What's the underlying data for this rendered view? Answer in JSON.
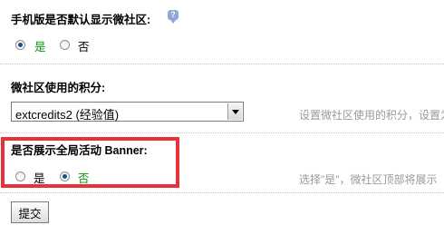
{
  "settings": {
    "mobile_default": {
      "title": "手机版是否默认显示微社区:",
      "help_icon": "help-bubble-icon",
      "options": [
        {
          "label": "是",
          "checked": true
        },
        {
          "label": "否",
          "checked": false
        }
      ]
    },
    "credits": {
      "title": "微社区使用的积分:",
      "selected_value": "extcredits2 (经验值)",
      "tip": "设置微社区使用的积分，设置为"
    },
    "banner": {
      "title": "是否展示全局活动 Banner:",
      "options": [
        {
          "label": "是",
          "checked": false
        },
        {
          "label": "否",
          "checked": true
        }
      ],
      "tip": "选择\"是\"，微社区顶部将展示"
    }
  },
  "actions": {
    "submit_label": "提交"
  },
  "colors": {
    "highlight_border": "#e8323a",
    "selected_option_text": "#0a9a0a",
    "tip_text": "#999999"
  }
}
